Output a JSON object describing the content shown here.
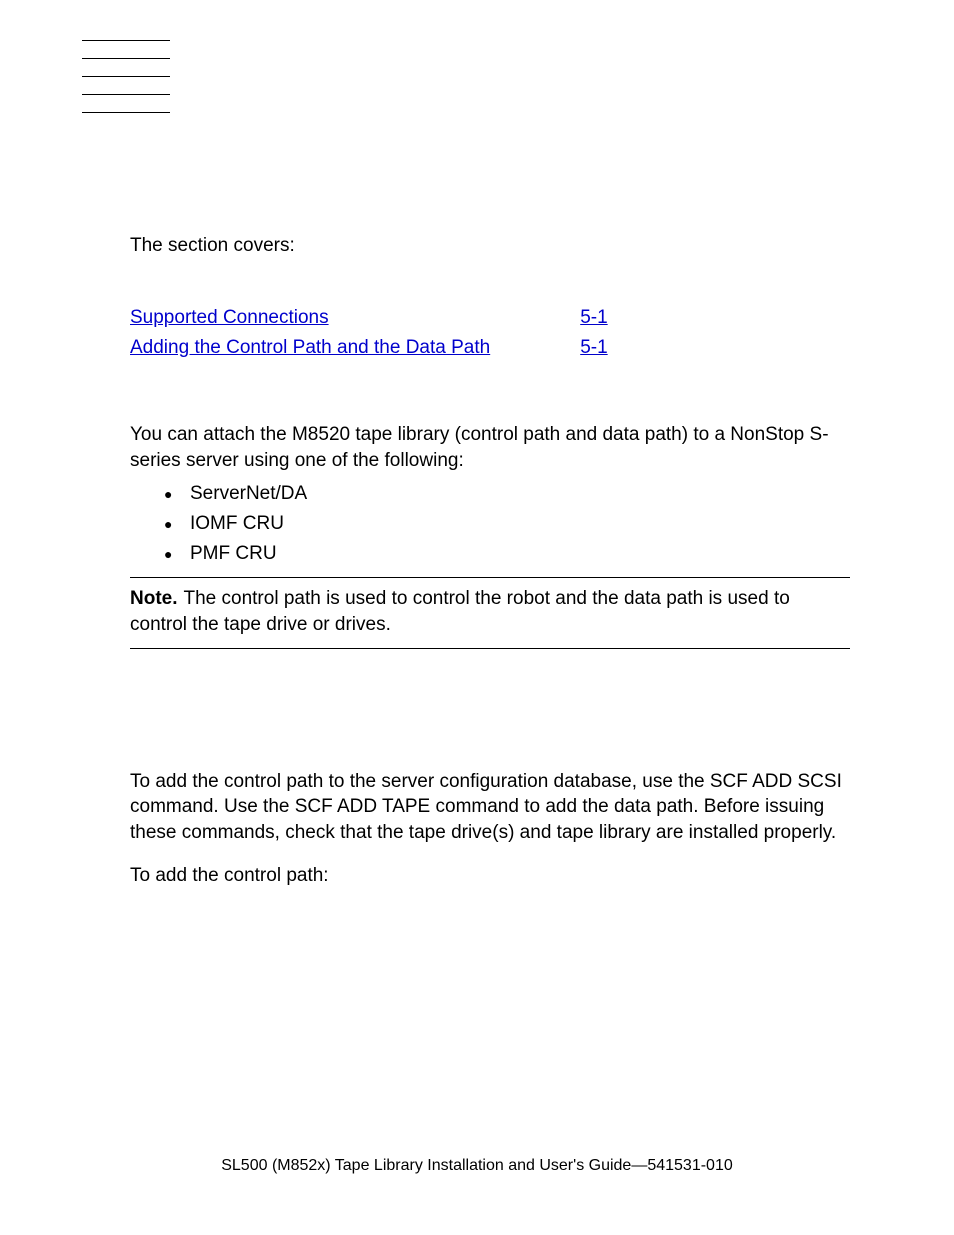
{
  "intro": "The section covers:",
  "toc": [
    {
      "label": "Supported Connections",
      "page": "5-1"
    },
    {
      "label": "Adding the Control Path and the Data Path",
      "page": "5-1"
    }
  ],
  "section1": {
    "para": "You can attach the M8520 tape library (control path and data path) to a NonStop S-series server using one of the following:",
    "bullets": [
      "ServerNet/DA",
      "IOMF CRU",
      "PMF CRU"
    ],
    "note_label": "Note.",
    "note_text": "The control path is used to control the robot and the data path is used to control the tape drive or drives."
  },
  "section2": {
    "para1": "To add the control path to the server configuration database, use the SCF ADD SCSI command. Use the SCF ADD TAPE command to add the data path. Before issuing these commands, check that the tape drive(s) and tape library are installed properly.",
    "para2": "To add the control path:"
  },
  "footer": "SL500 (M852x) Tape Library Installation and User's Guide—541531-010"
}
